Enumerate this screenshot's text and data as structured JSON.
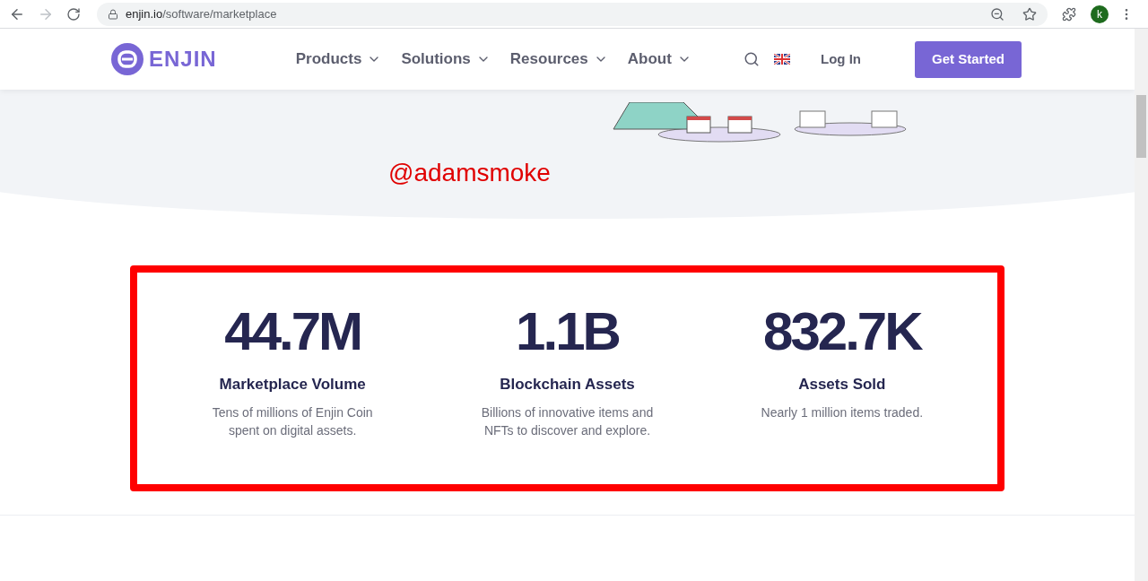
{
  "browser": {
    "url_domain": "enjin.io",
    "url_path": "/software/marketplace",
    "profile_initial": "k"
  },
  "nav": {
    "logo": "ENJIN",
    "menu": [
      {
        "label": "Products"
      },
      {
        "label": "Solutions"
      },
      {
        "label": "Resources"
      },
      {
        "label": "About"
      }
    ],
    "login": "Log In",
    "cta": "Get Started"
  },
  "annotation": "@adamsmoke",
  "stats": [
    {
      "value": "44.7M",
      "title": "Marketplace Volume",
      "description": "Tens of millions of Enjin Coin spent on digital assets."
    },
    {
      "value": "1.1B",
      "title": "Blockchain Assets",
      "description": "Billions of innovative items and NFTs to discover and explore."
    },
    {
      "value": "832.7K",
      "title": "Assets Sold",
      "description": "Nearly 1 million items traded."
    }
  ]
}
